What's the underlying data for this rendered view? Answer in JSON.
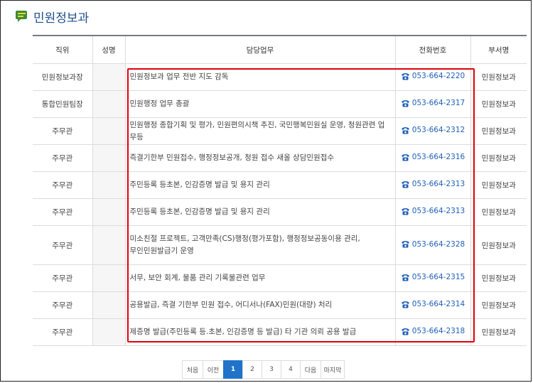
{
  "page": {
    "title": "민원정보과"
  },
  "table": {
    "headers": [
      "직위",
      "성명",
      "담당업무",
      "전화번호",
      "부서명"
    ],
    "rows": [
      {
        "position": "민원정보과장",
        "duty": "민원정보과 업무 전반 지도 감독",
        "phone": "053-664-2220",
        "dept": "민원정보과"
      },
      {
        "position": "통합민원팀장",
        "duty": "민원행정 업무 총괄",
        "phone": "053-664-2317",
        "dept": "민원정보과"
      },
      {
        "position": "주무관",
        "duty": "민원행정 종합기획 및 평가, 민원편의시책 추진, 국민행복민원실 운영, 청원관련 업무등",
        "phone": "053-664-2312",
        "dept": "민원정보과"
      },
      {
        "position": "주무관",
        "duty": "즉결기한부 민원접수, 행정정보공개, 청원 접수 새올 상담민원접수",
        "phone": "053-664-2316",
        "dept": "민원정보과"
      },
      {
        "position": "주무관",
        "duty": "주민등록 등초본, 인감증명 발급 및 용지 관리",
        "phone": "053-664-2313",
        "dept": "민원정보과"
      },
      {
        "position": "주무관",
        "duty": "주민등록 등초본, 인감증명 발급 및 용지 관리",
        "phone": "053-664-2313",
        "dept": "민원정보과"
      },
      {
        "position": "주무관",
        "duty": "미소친절 프로젝트, 고객만족(CS)행정(평가포함), 행정정보공동이용 관리,",
        "duty2": "무인민원발급기 운영",
        "phone": "053-664-2328",
        "dept": "민원정보과"
      },
      {
        "position": "주무관",
        "duty": "서무, 보안 회계, 물품 관리 기록물관련 업무",
        "phone": "053-664-2315",
        "dept": "민원정보과"
      },
      {
        "position": "주무관",
        "duty": "공용발급, 즉결 기한부 민원 접수, 어디서나(FAX)민원(대량) 처리",
        "phone": "053-664-2314",
        "dept": "민원정보과"
      },
      {
        "position": "주무관",
        "duty": "제증명 발급(주민등록 등.초본, 인감증명 등 발급) 타 기관 의뢰 공용 발급",
        "phone": "053-664-2318",
        "dept": "민원정보과"
      }
    ]
  },
  "pagination": {
    "first": "처음",
    "prev": "이전",
    "pages": [
      "1",
      "2",
      "3",
      "4"
    ],
    "current": "1",
    "next": "다음",
    "last": "마지막"
  },
  "colors": {
    "accent": "#1f73c9",
    "title": "#1f4e8c",
    "highlight": "#e0000a",
    "phone": "#1f5fb6"
  },
  "icons": {
    "title": "speech-bubble-icon",
    "phone": "phone-icon"
  }
}
